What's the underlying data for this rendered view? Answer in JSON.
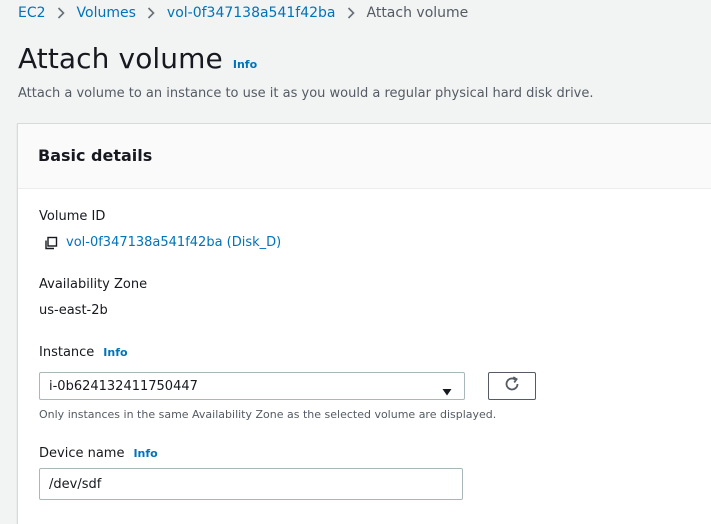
{
  "breadcrumb": {
    "items": [
      {
        "label": "EC2"
      },
      {
        "label": "Volumes"
      },
      {
        "label": "vol-0f347138a541f42ba"
      },
      {
        "label": "Attach volume"
      }
    ]
  },
  "header": {
    "title": "Attach volume",
    "info_label": "Info",
    "description": "Attach a volume to an instance to use it as you would a regular physical hard disk drive."
  },
  "basic_details": {
    "heading": "Basic details",
    "volume_id": {
      "label": "Volume ID",
      "value": "vol-0f347138a541f42ba (Disk_D)",
      "icon": "copy-icon"
    },
    "availability_zone": {
      "label": "Availability Zone",
      "value": "us-east-2b"
    },
    "instance": {
      "label": "Instance",
      "info_label": "Info",
      "selected": "i-0b624132411750447",
      "hint": "Only instances in the same Availability Zone as the selected volume are displayed.",
      "refresh_icon": "refresh-icon"
    },
    "device_name": {
      "label": "Device name",
      "info_label": "Info",
      "value": "/dev/sdf"
    }
  },
  "colors": {
    "link": "#0073bb",
    "text": "#16191f",
    "secondary_text": "#545b64",
    "page_background": "#f2f3f3",
    "border": "#aab7b8"
  }
}
